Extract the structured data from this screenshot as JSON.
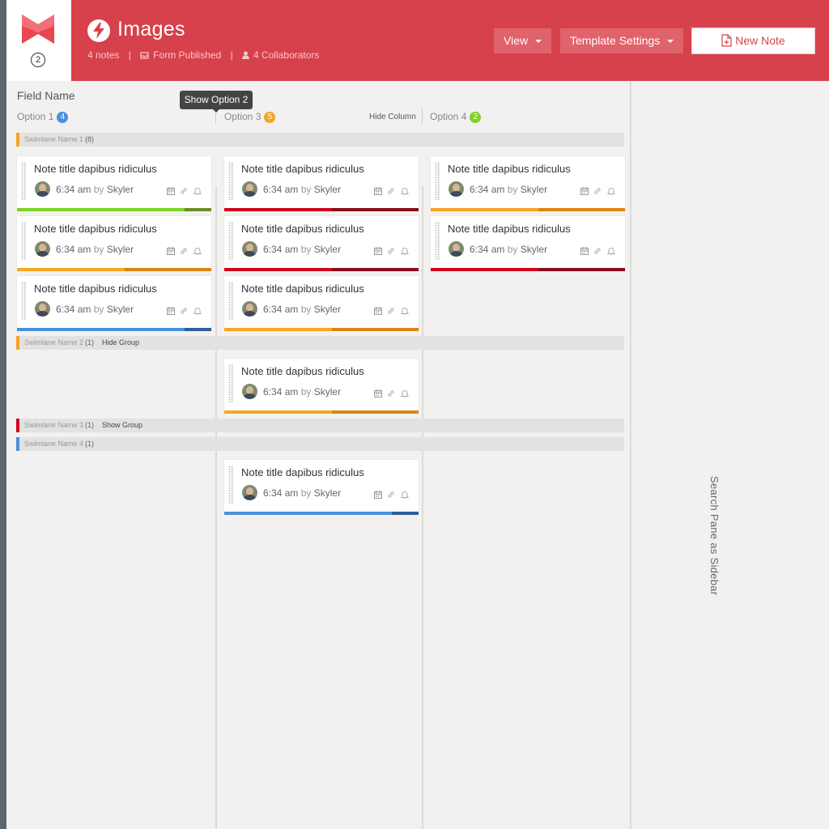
{
  "header": {
    "logo_badge": "2",
    "title": "Images",
    "meta": {
      "notes": "4 notes",
      "form": "Form Published",
      "collaborators": "4 Collaborators"
    },
    "buttons": {
      "view": "View",
      "template_settings": "Template Settings",
      "new_note": "New Note"
    },
    "colors": {
      "brand": "#d7414b"
    }
  },
  "board": {
    "field_name": "Field Name",
    "tooltip": "Show Option 2",
    "hide_column": "Hide Column",
    "columns": [
      {
        "label": "Option 1",
        "count": "4",
        "color": "#4a90d9"
      },
      {
        "label": "Option 3",
        "count": "5",
        "color": "#f5a623"
      },
      {
        "label": "Option 4",
        "count": "2",
        "color": "#7ed321"
      }
    ],
    "swimlanes": [
      {
        "name": "Swimlane Name 1",
        "count": "(8)",
        "action": "",
        "color": "#f5a623"
      },
      {
        "name": "Swimlane Name 2",
        "count": "(1)",
        "action": "Hide Group",
        "color": "#f5a623"
      },
      {
        "name": "Swimlane Name 3",
        "count": "(1)",
        "action": "Show Group",
        "color": "#d0021b"
      },
      {
        "name": "Swimlane Name 4",
        "count": "(1)",
        "action": "",
        "color": "#4a90d9"
      }
    ],
    "note": {
      "title": "Note title dapibus ridiculus",
      "time": "6:34 am",
      "by": "by",
      "author": "Skyler"
    },
    "cards": [
      {
        "color": "green"
      },
      {
        "color": "red"
      },
      {
        "color": "orange"
      },
      {
        "color": "orange"
      },
      {
        "color": "red"
      },
      {
        "color": "red"
      },
      {
        "color": "blue"
      },
      {
        "color": "orange"
      },
      {
        "color": "orange"
      },
      {
        "color": "blue"
      }
    ],
    "bar_colors": {
      "green": [
        "#7ed321",
        "#6c8a2a"
      ],
      "red": [
        "#d0021b",
        "#8b0a1e"
      ],
      "orange": [
        "#f5a623",
        "#d9860f"
      ],
      "blue": [
        "#4a90d9",
        "#2f5f96"
      ]
    }
  },
  "sidebar": {
    "label": "Search Pane as Sidebar"
  }
}
